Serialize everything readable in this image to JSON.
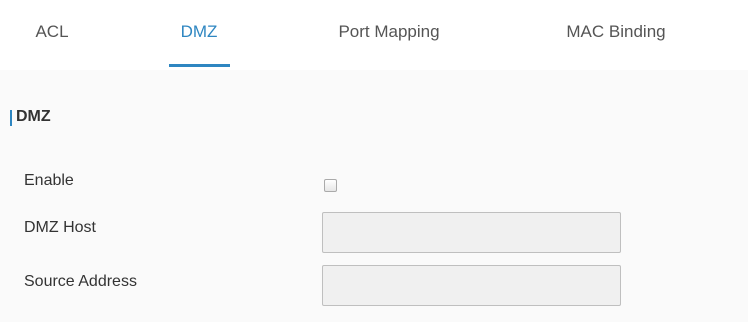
{
  "tabs": [
    {
      "label": "ACL",
      "active": false
    },
    {
      "label": "DMZ",
      "active": true
    },
    {
      "label": "Port Mapping",
      "active": false
    },
    {
      "label": "MAC Binding",
      "active": false
    }
  ],
  "section": {
    "title": "DMZ"
  },
  "form": {
    "enable": {
      "label": "Enable",
      "checked": false
    },
    "dmz_host": {
      "label": "DMZ Host",
      "value": ""
    },
    "source_address": {
      "label": "Source Address",
      "value": ""
    }
  },
  "colors": {
    "accent": "#2e86c1",
    "panel_bg": "#fafafa",
    "input_bg": "#f0f0f0",
    "text": "#333333"
  }
}
